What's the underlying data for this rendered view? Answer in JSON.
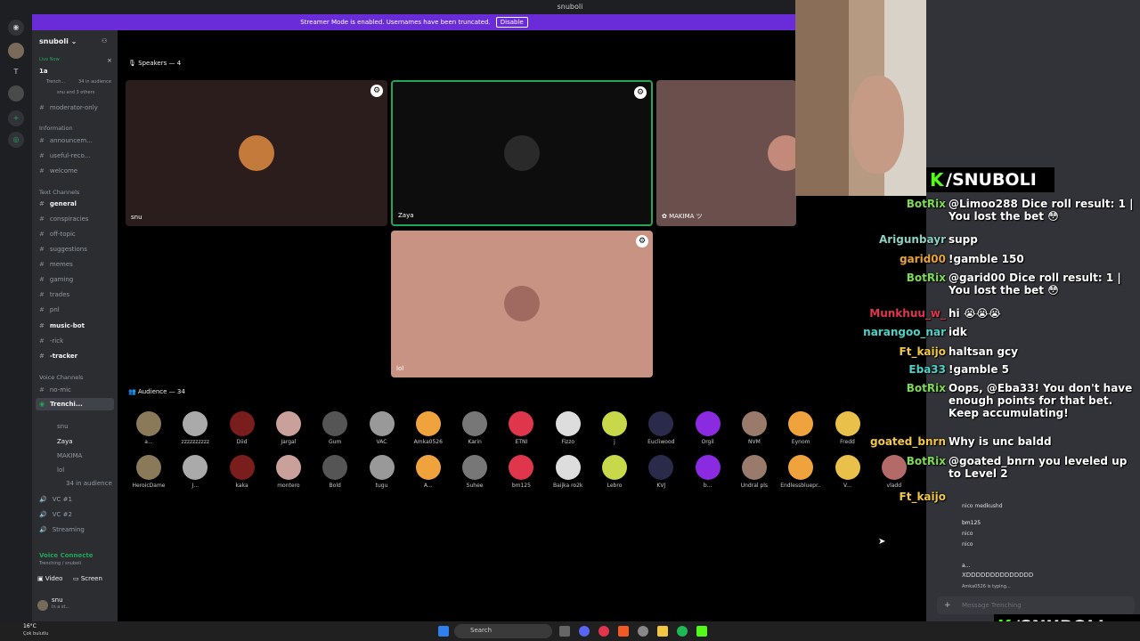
{
  "app": {
    "title": "snuboli",
    "streamer_banner": "Streamer Mode is enabled. Usernames have been truncated.",
    "disable_label": "Disable"
  },
  "sidebar": {
    "server_name": "snuboli ⌄",
    "top_item": "1a",
    "live_now": "Live Now",
    "live_stage": "Trench...",
    "live_audience": "34 in audience",
    "live_people": "snu and 3 others",
    "moderator_only": "moderator-only",
    "information_cat": "Information",
    "info_channels": [
      "announcem...",
      "useful-reco...",
      "welcome"
    ],
    "text_cat": "Text Channels",
    "text_channels": [
      "general",
      "conspiracies",
      "off-topic",
      "suggestions",
      "memes",
      "gaming",
      "trades",
      "pnl",
      "music-bot",
      "-rick",
      "-tracker"
    ],
    "voice_cat": "Voice Channels",
    "no_mic": "no-mic",
    "stage_name": "Trenchi...",
    "stage_members": [
      "snu",
      "Zaya",
      "MAKIMA",
      "lol"
    ],
    "stage_audience": "34 in audience",
    "voice_channels": [
      "VC #1",
      "VC #2",
      "Streaming"
    ],
    "voice_connected": "Voice Connecte",
    "voice_sub": "Trenching / snuboli",
    "video_label": "Video",
    "screen_label": "Screen",
    "user_name": "snu",
    "user_status": "In a st..."
  },
  "stage": {
    "speakers_label": "Speakers — 4",
    "speakers": [
      {
        "name": "snu",
        "bg": "#2a1d1c"
      },
      {
        "name": "Zaya",
        "bg": "#0d0d0d"
      },
      {
        "name": "✿ MAKIMA ツ",
        "bg": "#6b4f4c"
      },
      {
        "name": "lol",
        "bg": "#c99384"
      }
    ],
    "audience_label": "Audience — 34",
    "audience_row1": [
      "a...",
      "zzzzzzzzzz",
      "Diid",
      "Jargal",
      "Gum",
      "VAC",
      "Amka0526",
      "Karin",
      "ETNI",
      "Fizzo",
      "j",
      "Eucliwood",
      "Orgil",
      "NVM",
      "Eynom",
      "Fredd"
    ],
    "audience_row2": [
      "HeroicDame",
      "J...",
      "kaka",
      "montero",
      "Bold",
      "tugu",
      "A...",
      "Suhee",
      "bm125",
      "Baijka ro2k",
      "Lebro",
      "KVJ",
      "b...",
      "Undral pls",
      "Endlessbluepr...",
      "V...",
      "vladd"
    ]
  },
  "overlay": {
    "brand_top": "/SNUBOLI",
    "brand_bottom": "/SNUBOLI",
    "chat": [
      {
        "user": "BotRix",
        "color": "#7ed957",
        "msg": "@Limoo288 Dice roll result: 1 | You lost the bet 😳"
      },
      {
        "user": "Arigunbayr",
        "color": "#8bd0c2",
        "msg": "supp"
      },
      {
        "user": "garid00",
        "color": "#e8a33c",
        "msg": "!gamble 150"
      },
      {
        "user": "BotRix",
        "color": "#7ed957",
        "msg": "@garid00 Dice roll result: 1 | You lost the bet 😳"
      },
      {
        "user": "Munkhuu_w_",
        "color": "#e0364b",
        "msg": "hi 😭😭😭"
      },
      {
        "user": "narangoo_nar",
        "color": "#4fd1c5",
        "msg": "idk"
      },
      {
        "user": "Ft_kaijo",
        "color": "#f2c744",
        "msg": "haltsan gcy"
      },
      {
        "user": "Eba33",
        "color": "#4fd1c5",
        "msg": "!gamble 5"
      },
      {
        "user": "BotRix",
        "color": "#7ed957",
        "msg": "Oops, @Eba33! You don't have enough points for that bet. Keep accumulating!"
      },
      {
        "user": "goated_bnrn",
        "color": "#f2c744",
        "msg": "Why is unc baldd"
      },
      {
        "user": "BotRix",
        "color": "#7ed957",
        "msg": "@goated_bnrn you leveled up to Level 2"
      },
      {
        "user": "Ft_kaijo",
        "color": "#f2c744",
        "msg": ""
      }
    ],
    "discord_msgs": [
      {
        "author": "bm125",
        "time": "9:11 PM",
        "lines": [
          "nico",
          "nico"
        ]
      },
      {
        "author": "a...",
        "time": "9:11 PM",
        "lines": [
          "XDDDDDDDDDDDDDD"
        ]
      }
    ],
    "partial_msg": "nico medkushd",
    "typing": "Amka0526 is typing...",
    "message_placeholder": "Message Trenching"
  },
  "taskbar": {
    "weather": "16°C",
    "weather_sub": "Çok bulutlu",
    "search": "Search"
  }
}
